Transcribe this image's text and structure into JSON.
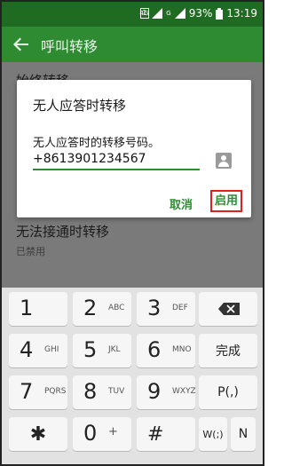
{
  "status_bar": {
    "left_icon": "notification-icon",
    "signal_label": "4G",
    "wifi_label": "G",
    "battery": "93%",
    "time": "13:19"
  },
  "app_bar": {
    "title": "呼叫转移",
    "back_icon": "back-arrow-icon"
  },
  "settings_list": {
    "items": [
      {
        "title": "始终转移",
        "subtitle": ""
      },
      {
        "title": "无法接通时转移",
        "subtitle": "已禁用"
      }
    ]
  },
  "dialog": {
    "title": "无人应答时转移",
    "message": "无人应答时的转移号码。",
    "input_value": "+8613901234567",
    "contact_icon": "contact-icon",
    "cancel_label": "取消",
    "enable_label": "启用"
  },
  "keyboard": {
    "keys": [
      {
        "num": "1",
        "sub": ""
      },
      {
        "num": "2",
        "sub": "ABC"
      },
      {
        "num": "3",
        "sub": "DEF"
      },
      {
        "num": "4",
        "sub": "GHI"
      },
      {
        "num": "5",
        "sub": "JKL"
      },
      {
        "num": "6",
        "sub": "MNO"
      },
      {
        "num": "7",
        "sub": "PQRS"
      },
      {
        "num": "8",
        "sub": "TUV"
      },
      {
        "num": "9",
        "sub": "WXYZ"
      },
      {
        "num": "0",
        "sub": "+"
      }
    ],
    "done_label": "完成",
    "pause_label": "P(,)",
    "wait_label": "W(;)",
    "n_label": "N",
    "star_label": "✱",
    "hash_label": "#",
    "backspace_icon": "backspace-icon"
  }
}
